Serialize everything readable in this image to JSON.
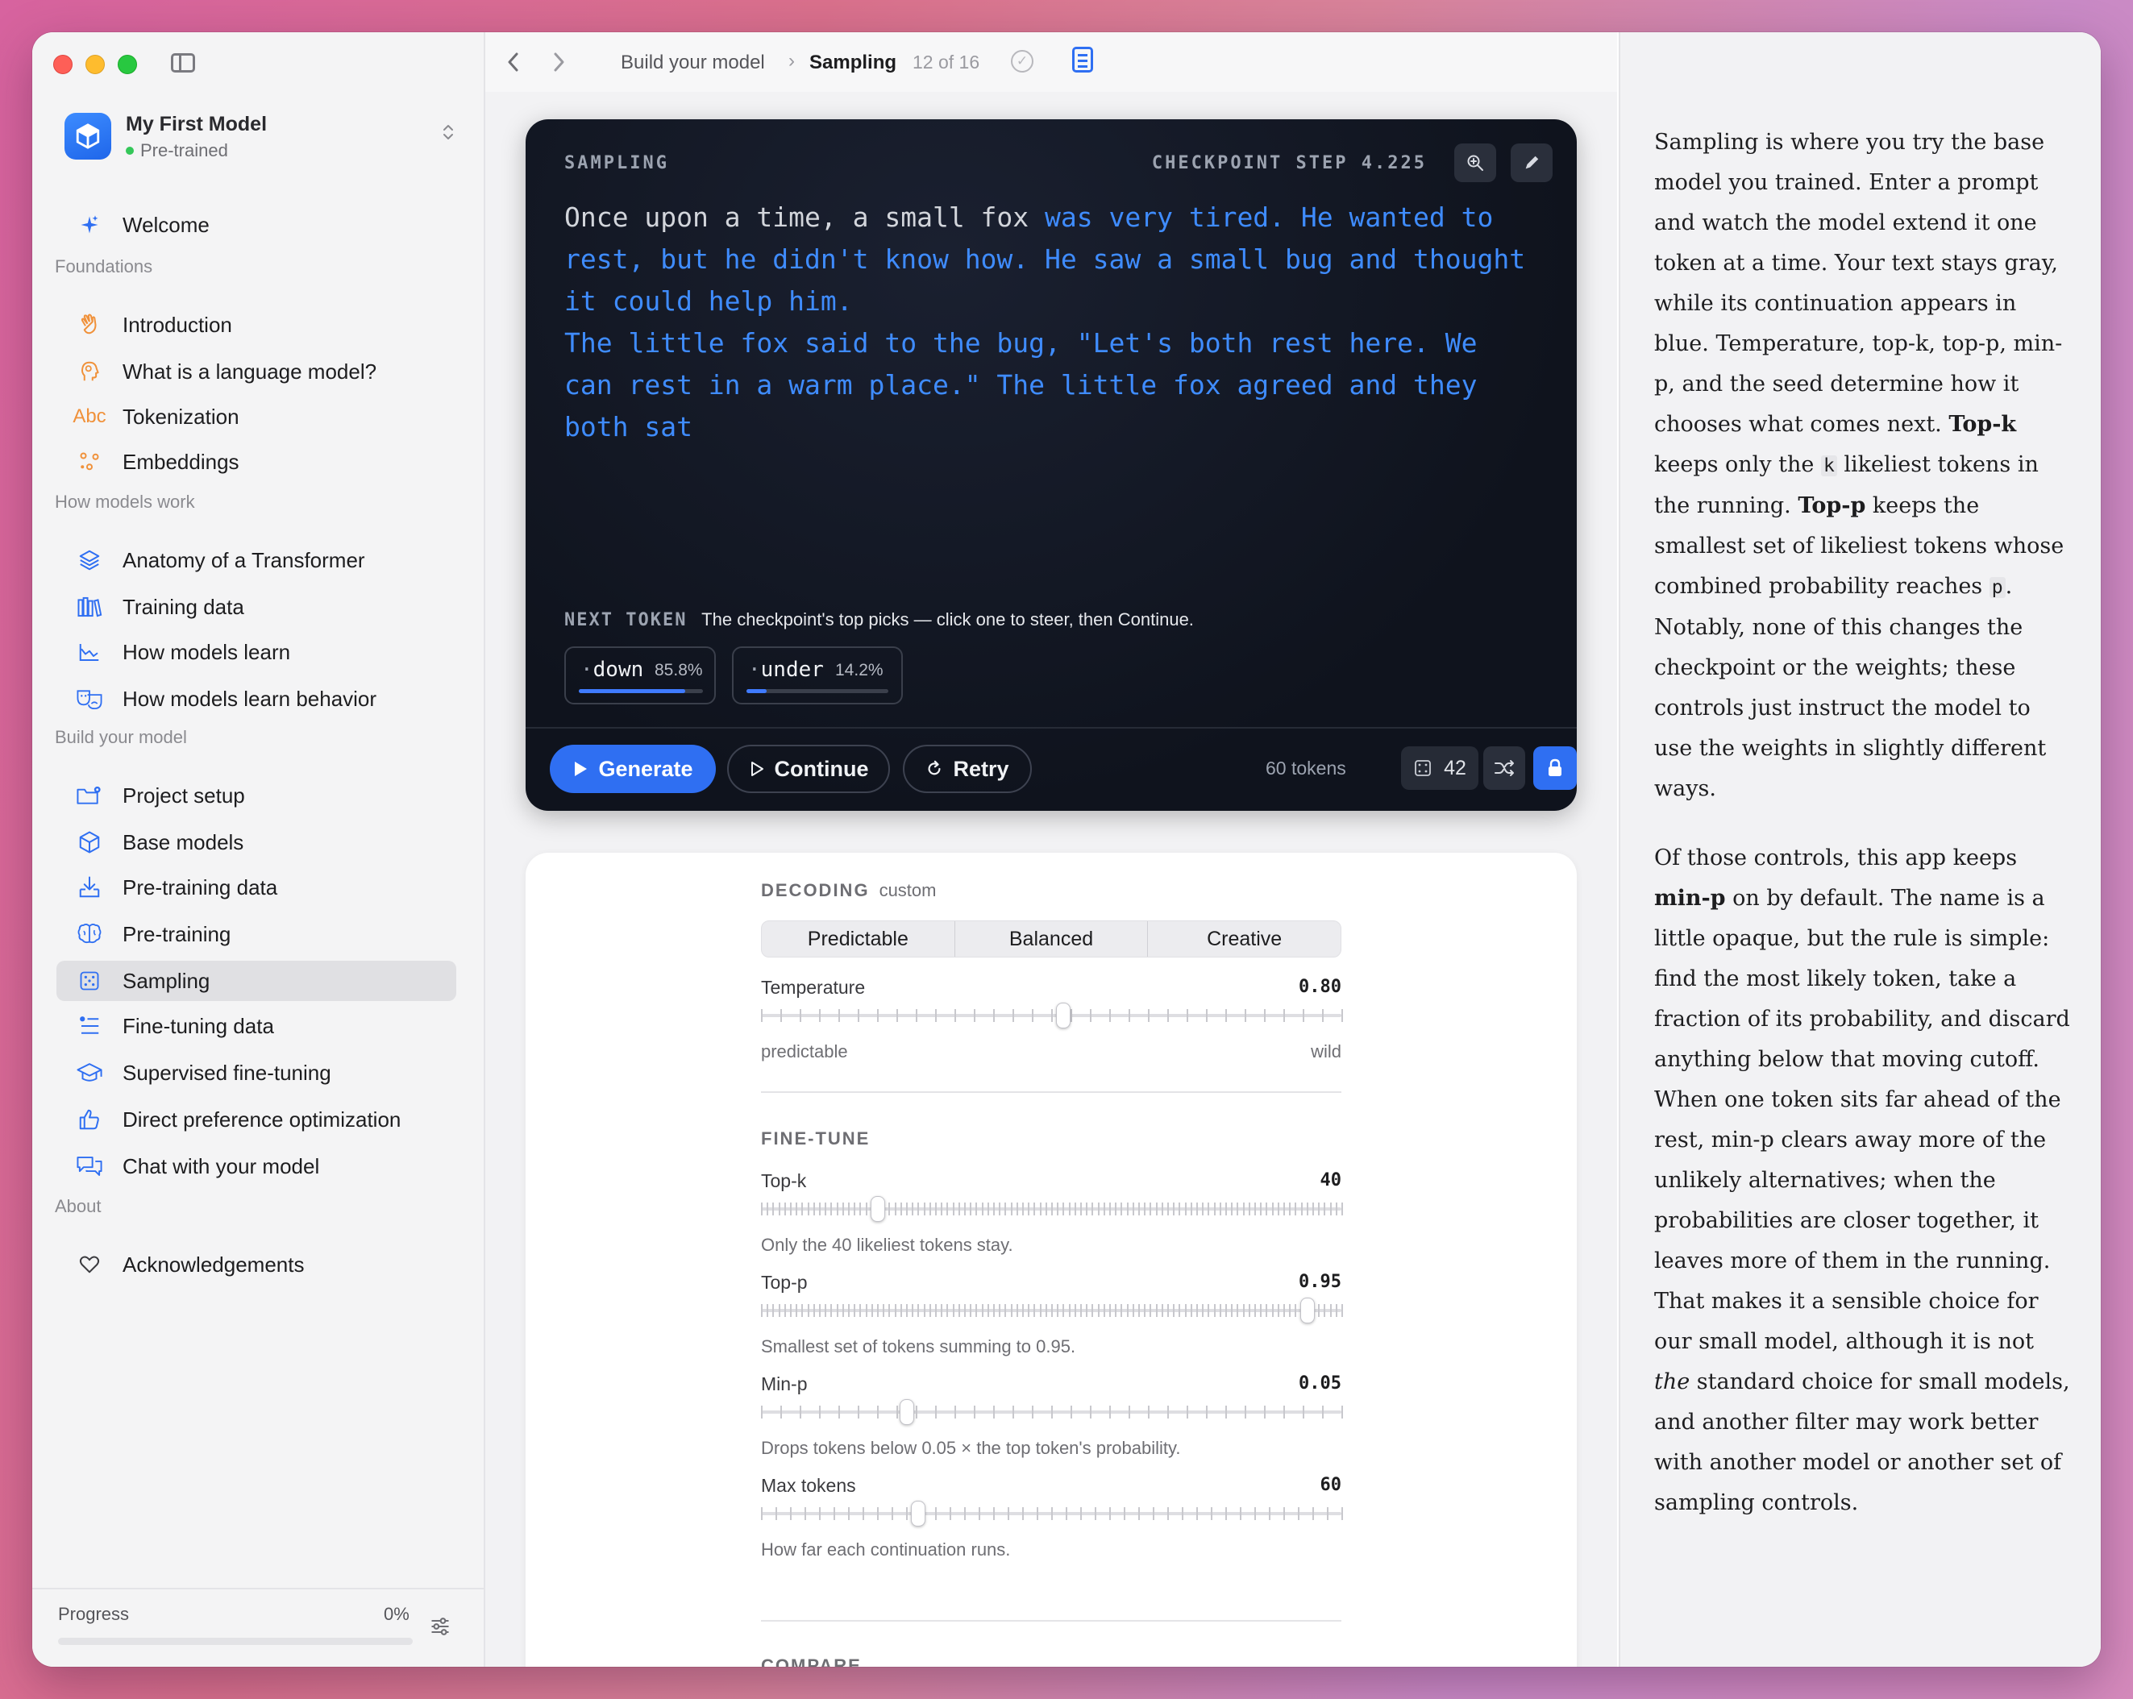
{
  "sidebar": {
    "model": {
      "name": "My First Model",
      "status": "Pre-trained"
    },
    "welcome": "Welcome",
    "sections": [
      {
        "title": "Foundations"
      },
      {
        "title": "How models work"
      },
      {
        "title": "Build your model"
      },
      {
        "title": "About"
      }
    ],
    "items": [
      {
        "label": "Introduction",
        "icon": "wave-hand-icon"
      },
      {
        "label": "What is a language model?",
        "icon": "head-profile-icon"
      },
      {
        "label": "Tokenization",
        "icon": "abc-icon",
        "icon_text": "Abc"
      },
      {
        "label": "Embeddings",
        "icon": "scatter-dots-icon"
      },
      {
        "label": "Anatomy of a Transformer",
        "icon": "layers-icon"
      },
      {
        "label": "Training data",
        "icon": "books-icon"
      },
      {
        "label": "How models learn",
        "icon": "trend-chart-icon"
      },
      {
        "label": "How models learn behavior",
        "icon": "theater-masks-icon"
      },
      {
        "label": "Project setup",
        "icon": "folder-gear-icon"
      },
      {
        "label": "Base models",
        "icon": "cube-icon"
      },
      {
        "label": "Pre-training data",
        "icon": "download-tray-icon"
      },
      {
        "label": "Pre-training",
        "icon": "brain-icon"
      },
      {
        "label": "Sampling",
        "icon": "dice-icon"
      },
      {
        "label": "Fine-tuning data",
        "icon": "checklist-icon"
      },
      {
        "label": "Supervised fine-tuning",
        "icon": "graduation-cap-icon"
      },
      {
        "label": "Direct preference optimization",
        "icon": "thumbs-up-icon"
      },
      {
        "label": "Chat with your model",
        "icon": "chat-bubbles-icon"
      },
      {
        "label": "Acknowledgements",
        "icon": "heart-icon"
      }
    ],
    "active_item": "Sampling",
    "progress": {
      "label": "Progress",
      "value": "0%",
      "fraction": 0
    }
  },
  "topbar": {
    "breadcrumb_parent": "Build your model",
    "breadcrumb_current": "Sampling",
    "step_count": "12 of 16"
  },
  "sampling": {
    "label": "SAMPLING",
    "checkpoint": "CHECKPOINT STEP 4.225",
    "prompt": "Once upon a time, a small fox ",
    "continuation": "was very tired. He wanted to rest, but he didn't know how. He saw a small bug and thought it could help him.\nThe little fox said to the bug, \"Let's both rest here. We can rest in a warm place.\" The little fox agreed and they both sat",
    "next_token_label": "NEXT TOKEN",
    "next_token_hint": "The checkpoint's top picks — click one to steer, then Continue.",
    "candidates": [
      {
        "token": "down",
        "pct": "85.8%",
        "prob": 0.858
      },
      {
        "token": "under",
        "pct": "14.2%",
        "prob": 0.142
      }
    ],
    "buttons": {
      "generate": "Generate",
      "continue": "Continue",
      "retry": "Retry"
    },
    "tokens": "60 tokens",
    "seed": "42"
  },
  "controls": {
    "decoding_label": "DECODING",
    "decoding_mode": "custom",
    "presets": [
      "Predictable",
      "Balanced",
      "Creative"
    ],
    "temperature": {
      "name": "Temperature",
      "value": "0.80",
      "fraction": 0.52,
      "min_label": "predictable",
      "max_label": "wild"
    },
    "finetune_label": "FINE-TUNE",
    "top_k": {
      "name": "Top-k",
      "value": "40",
      "fraction": 0.2,
      "hint": "Only the 40 likeliest tokens stay."
    },
    "top_p": {
      "name": "Top-p",
      "value": "0.95",
      "fraction": 0.94,
      "hint": "Smallest set of tokens summing to 0.95."
    },
    "min_p": {
      "name": "Min-p",
      "value": "0.05",
      "fraction": 0.25,
      "hint": "Drops tokens below 0.05 × the top token's probability."
    },
    "max_tokens": {
      "name": "Max tokens",
      "value": "60",
      "fraction": 0.27,
      "hint": "How far each continuation runs."
    },
    "compare_label": "COMPARE"
  },
  "reader": {
    "p1": [
      {
        "t": "Sampling is where you try the base model you trained. Enter a prompt and watch the model extend it one token at a time. Your text stays gray, while its continuation appears in blue. Temperature, top-k, top-p, min-p, and the seed determine how it chooses what comes next. "
      },
      {
        "t": "Top-k",
        "b": true
      },
      {
        "t": " keeps only the "
      },
      {
        "t": "k",
        "code": true
      },
      {
        "t": " likeliest tokens in the running. "
      },
      {
        "t": "Top-p",
        "b": true
      },
      {
        "t": " keeps the smallest set of likeliest tokens whose combined probability reaches "
      },
      {
        "t": "p",
        "code": true
      },
      {
        "t": ". Notably, none of this changes the checkpoint or the weights; these controls just instruct the model to use the weights in slightly different ways."
      }
    ],
    "p2": [
      {
        "t": "Of those controls, this app keeps "
      },
      {
        "t": "min-p",
        "b": true
      },
      {
        "t": " on by default. The name is a little opaque, but the rule is simple: find the most likely token, take a fraction of its probability, and discard anything below that moving cutoff. When one token sits far ahead of the rest, min-p clears away more of the unlikely alternatives; when the probabilities are closer together, it leaves more of them in the running. That makes it a sensible choice for our small model, although it is not "
      },
      {
        "t": "the",
        "i": true
      },
      {
        "t": " standard choice for small models, and another filter may work better with another model or another set of sampling controls."
      }
    ]
  }
}
